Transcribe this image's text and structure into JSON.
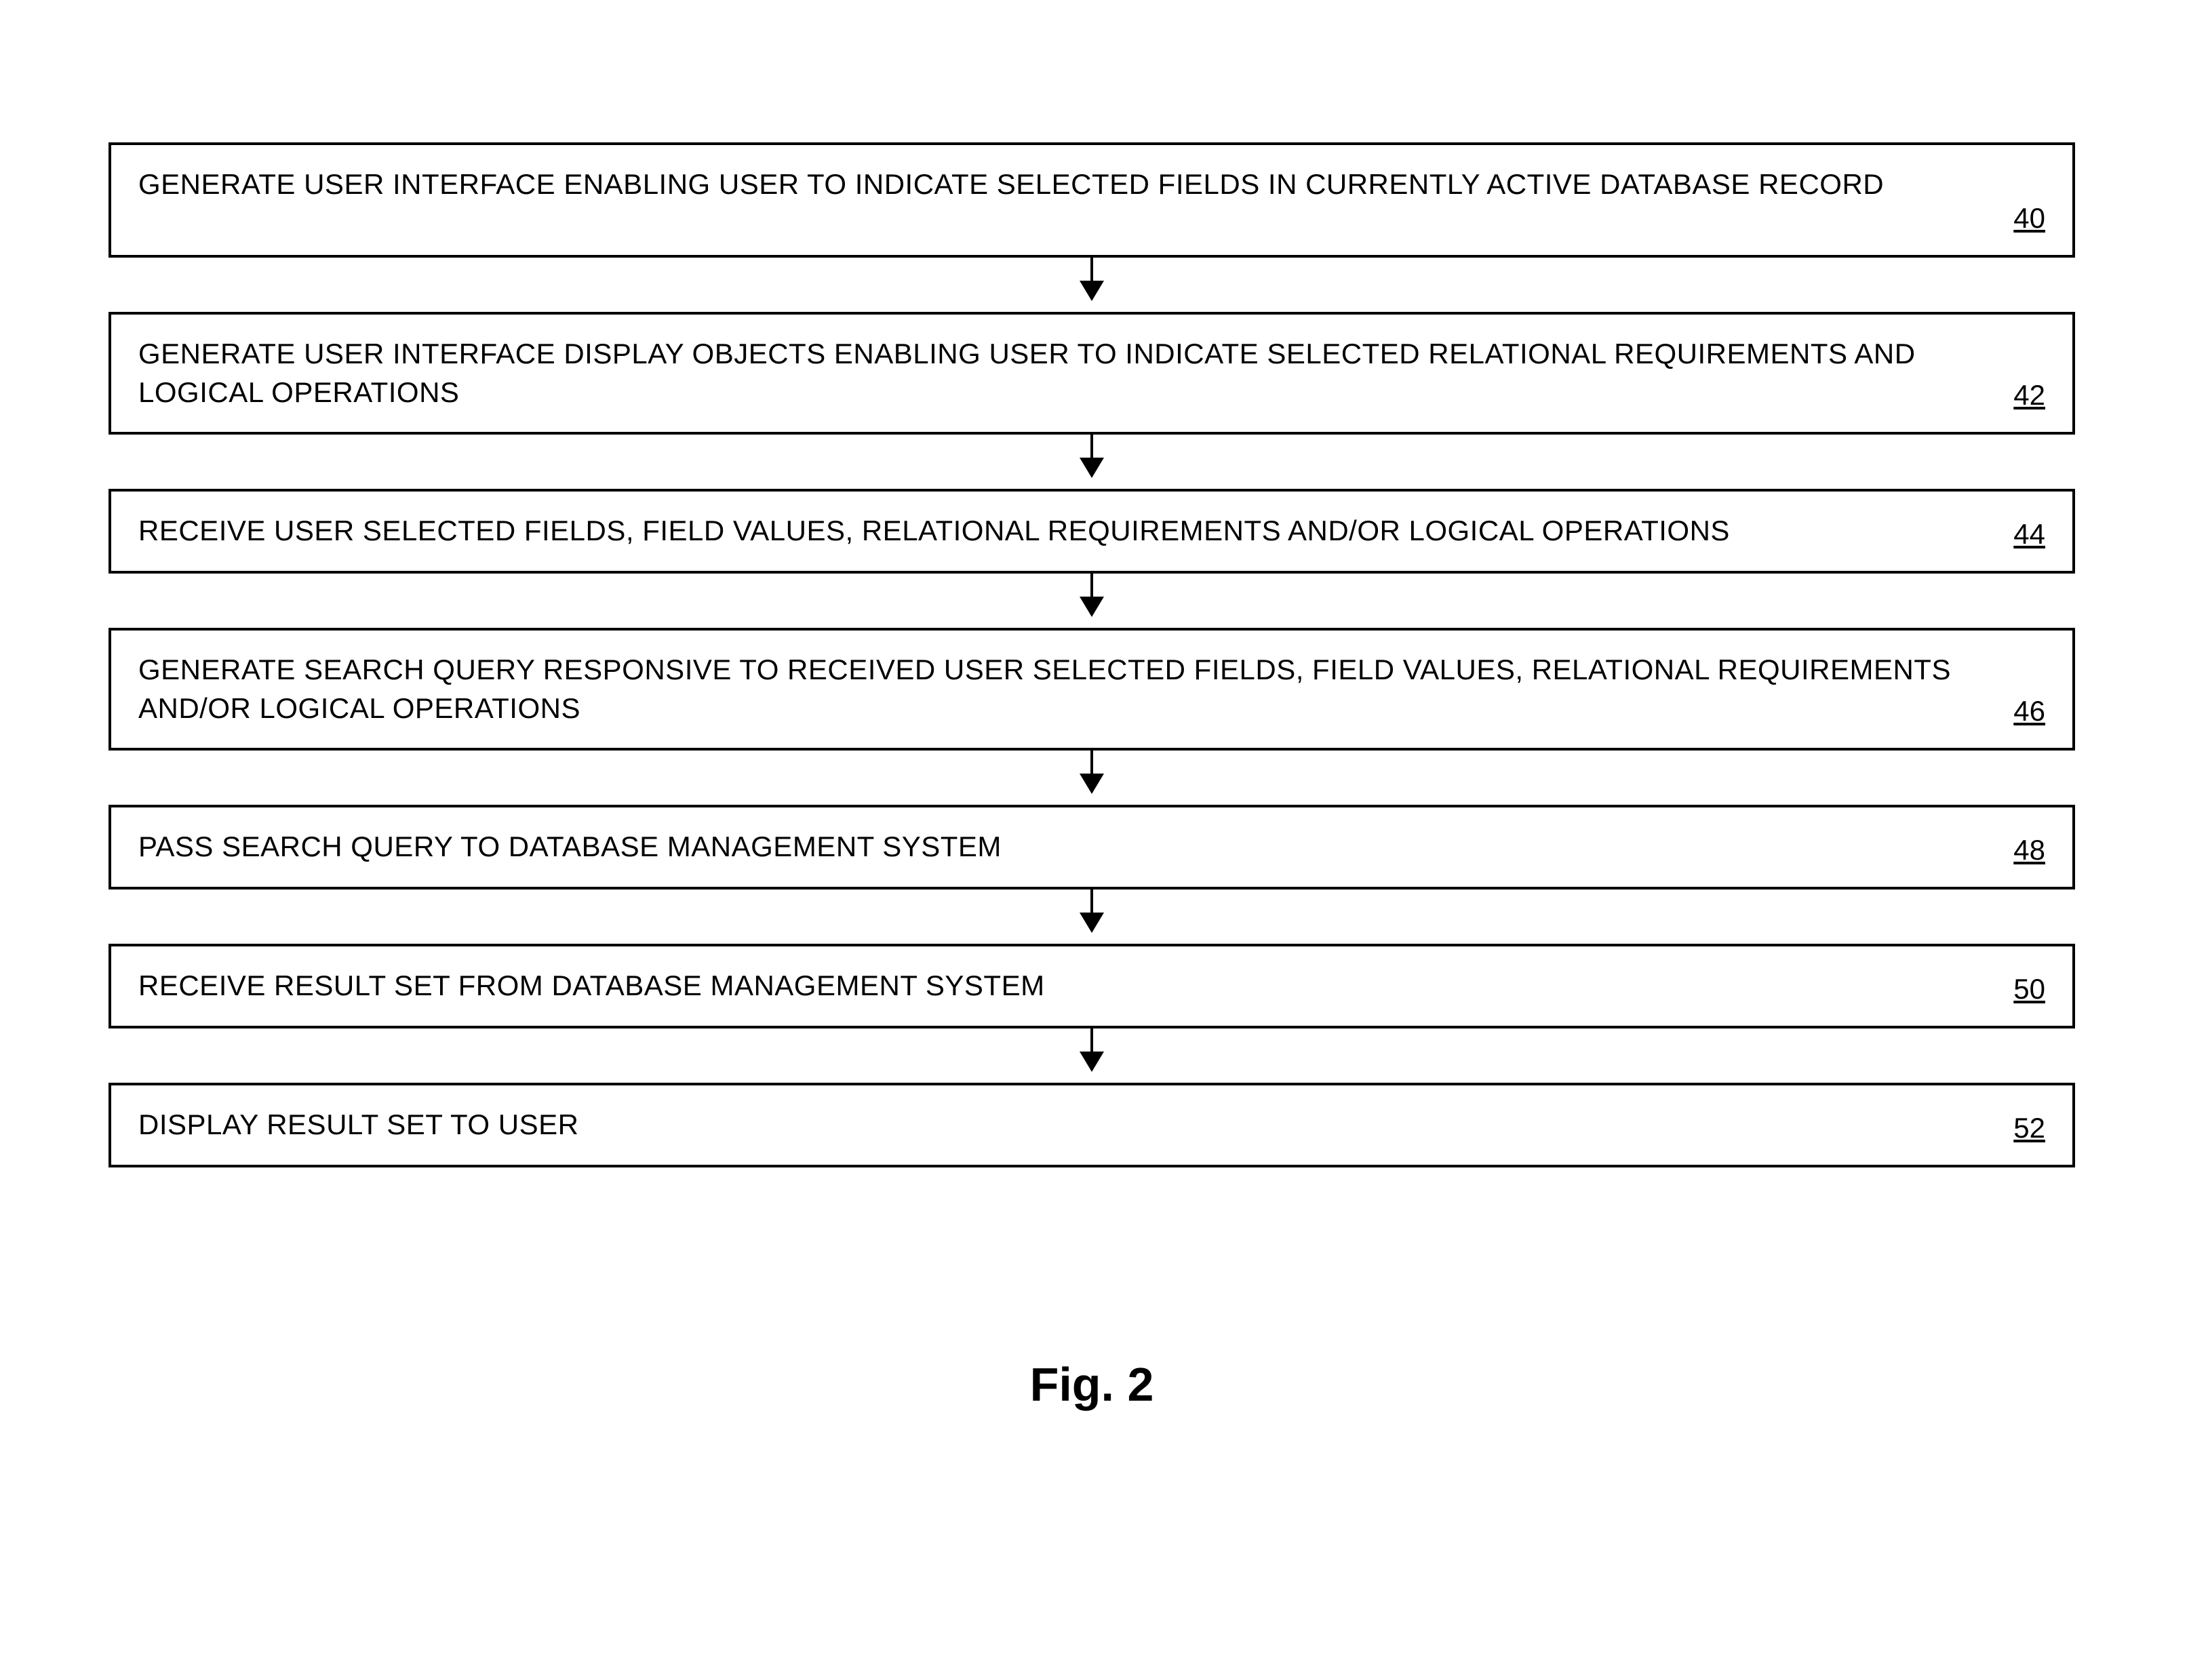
{
  "steps": [
    {
      "text": "GENERATE USER INTERFACE ENABLING USER TO INDICATE SELECTED FIELDS IN CURRENTLY ACTIVE DATABASE RECORD",
      "num": "40"
    },
    {
      "text": "GENERATE USER INTERFACE DISPLAY OBJECTS ENABLING USER TO INDICATE SELECTED RELATIONAL REQUIREMENTS AND LOGICAL OPERATIONS",
      "num": "42"
    },
    {
      "text": "RECEIVE USER SELECTED FIELDS, FIELD VALUES, RELATIONAL REQUIREMENTS AND/OR LOGICAL OPERATIONS",
      "num": "44"
    },
    {
      "text": "GENERATE SEARCH QUERY RESPONSIVE TO RECEIVED USER SELECTED FIELDS, FIELD VALUES, RELATIONAL REQUIREMENTS AND/OR LOGICAL OPERATIONS",
      "num": "46"
    },
    {
      "text": "PASS SEARCH QUERY TO DATABASE MANAGEMENT SYSTEM",
      "num": "48"
    },
    {
      "text": "RECEIVE RESULT SET FROM DATABASE MANAGEMENT SYSTEM",
      "num": "50"
    },
    {
      "text": "DISPLAY RESULT SET TO USER",
      "num": "52"
    }
  ],
  "caption": "Fig. 2"
}
